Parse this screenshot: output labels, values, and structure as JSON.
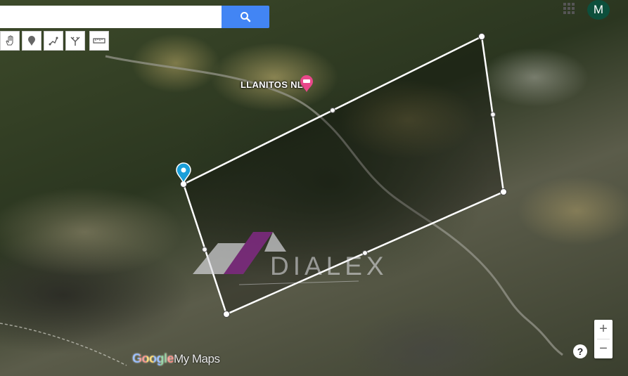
{
  "search": {
    "placeholder": "",
    "value": ""
  },
  "toolbar": {
    "tools": [
      "hand-tool",
      "marker-tool",
      "draw-line-tool",
      "directions-tool",
      "ruler-tool"
    ]
  },
  "header": {
    "avatar_letter": "M"
  },
  "map": {
    "place_label": "LLANITOS NL",
    "place_icon": "hotel-icon"
  },
  "watermark": {
    "text": "DIALEX"
  },
  "footer": {
    "logo_google": "Google",
    "logo_mymaps": "My Maps"
  },
  "controls": {
    "zoom_in": "+",
    "zoom_out": "−",
    "help": "?"
  },
  "colors": {
    "accent": "#4285f4",
    "avatar": "#0d4f3c",
    "pin": "#1a9fd9",
    "hotel_pin": "#e9488a",
    "watermark_purple": "#7c2a7e"
  }
}
